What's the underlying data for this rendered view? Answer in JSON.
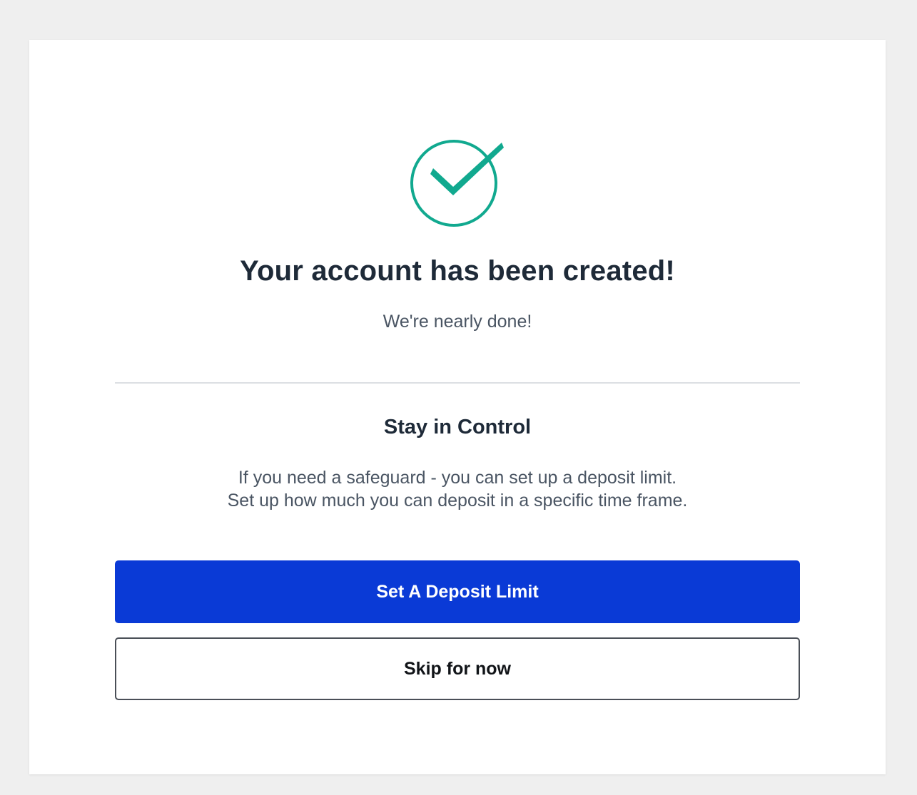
{
  "success": {
    "icon": "check-circle-icon",
    "title": "Your account has been created!",
    "subtitle": "We're nearly done!"
  },
  "control": {
    "title": "Stay in Control",
    "description_lines": [
      "If you need a safeguard - you can set up a deposit limit.",
      "Set up how much you can deposit in a specific time frame."
    ]
  },
  "actions": {
    "primary_label": "Set A Deposit Limit",
    "secondary_label": "Skip for now"
  },
  "colors": {
    "accent_green": "#11a98f",
    "primary_blue": "#0a3ad6",
    "heading": "#1e2a38",
    "body_text": "#4a5563"
  }
}
